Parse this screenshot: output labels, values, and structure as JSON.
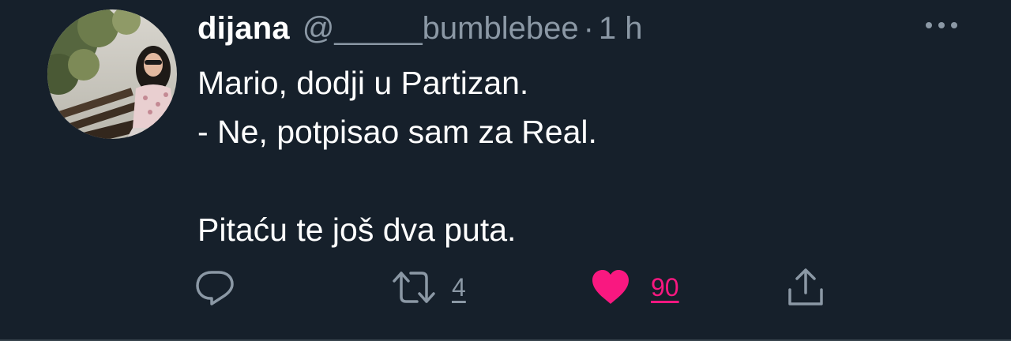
{
  "tweet": {
    "display_name": "dijana",
    "handle": "@_____bumblebee",
    "separator": "·",
    "time": "1 h",
    "text_lines": [
      "Mario, dodji u Partizan.",
      "- Ne, potpisao sam za Real.",
      "",
      "Pitaću te još dva puta."
    ]
  },
  "actions": {
    "reply_count": "",
    "retweet_count": "4",
    "like_count": "90",
    "liked": true
  },
  "icons": {
    "more": "more-dots-icon",
    "reply": "reply-bubble-icon",
    "retweet": "retweet-icon",
    "like": "heart-icon",
    "share": "share-icon"
  },
  "colors": {
    "background": "#16202b",
    "text": "#ffffff",
    "secondary": "#8b98a5",
    "like": "#f91880"
  }
}
